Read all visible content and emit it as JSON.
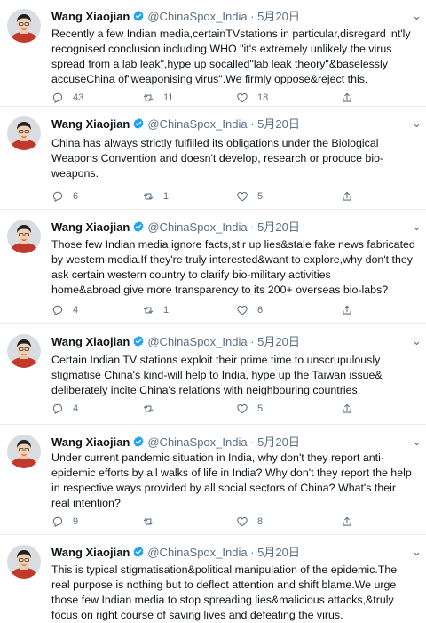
{
  "tweets": [
    {
      "name": "Wang Xiaojian",
      "handle": "@ChinaSpox_India",
      "sep": "·",
      "date": "5月20日",
      "text": "Recently a few Indian media,certainTVstations in particular,disregard int'ly recognised conclusion including WHO \"it's extremely unlikely the virus spread from a lab leak\",hype up socalled\"lab leak theory\"&baselessly accuseChina of\"weaponising virus\".We firmly oppose&reject this.",
      "replies": "43",
      "retweets": "11",
      "likes": "18"
    },
    {
      "name": "Wang Xiaojian",
      "handle": "@ChinaSpox_India",
      "sep": "·",
      "date": "5月20日",
      "text": "China has always strictly fulfilled its obligations under the Biological Weapons Convention and doesn't develop, research or produce bio-weapons.",
      "replies": "6",
      "retweets": "1",
      "likes": "5"
    },
    {
      "name": "Wang Xiaojian",
      "handle": "@ChinaSpox_India",
      "sep": "·",
      "date": "5月20日",
      "text": "Those few Indian media ignore facts,stir up lies&stale fake news fabricated by western media.If they're truly interested&want to explore,why don't they ask certain western country to clarify bio-military activities home&abroad,give more transparency to its 200+ overseas bio-labs?",
      "replies": "4",
      "retweets": "1",
      "likes": "6"
    },
    {
      "name": "Wang Xiaojian",
      "handle": "@ChinaSpox_India",
      "sep": "·",
      "date": "5月20日",
      "text": "Certain Indian TV stations exploit their prime time to unscrupulously stigmatise China's kind-will help to India, hype up the Taiwan issue& deliberately incite China's relations with neighbouring countries.",
      "replies": "4",
      "retweets": "",
      "likes": "5"
    },
    {
      "name": "Wang Xiaojian",
      "handle": "@ChinaSpox_India",
      "sep": "·",
      "date": "5月20日",
      "text": "Under current pandemic situation in India, why don't they report anti-epidemic efforts by all walks of life in India? Why don't they report the help in respective ways provided by all social sectors of China? What's their real intention?",
      "replies": "9",
      "retweets": "",
      "likes": "8"
    },
    {
      "name": "Wang Xiaojian",
      "handle": "@ChinaSpox_India",
      "sep": "·",
      "date": "5月20日",
      "text": "This is typical stigmatisation&political manipulation of the epidemic.The real purpose is nothing but to deflect attention and shift blame.We urge those few Indian media to stop spreading lies&malicious attacks,&truly focus on right course of saving lives and defeating the virus.",
      "replies": "",
      "retweets": "",
      "likes": ""
    }
  ],
  "icons": {
    "verified": "verified-badge-icon",
    "more": "more-options-icon",
    "reply": "reply-icon",
    "retweet": "retweet-icon",
    "like": "like-icon",
    "share": "share-icon"
  },
  "colors": {
    "verified": "#1da1f2",
    "secondary_text": "#5b7083",
    "divider": "#e6ecf0"
  },
  "more_glyph": "⌄"
}
